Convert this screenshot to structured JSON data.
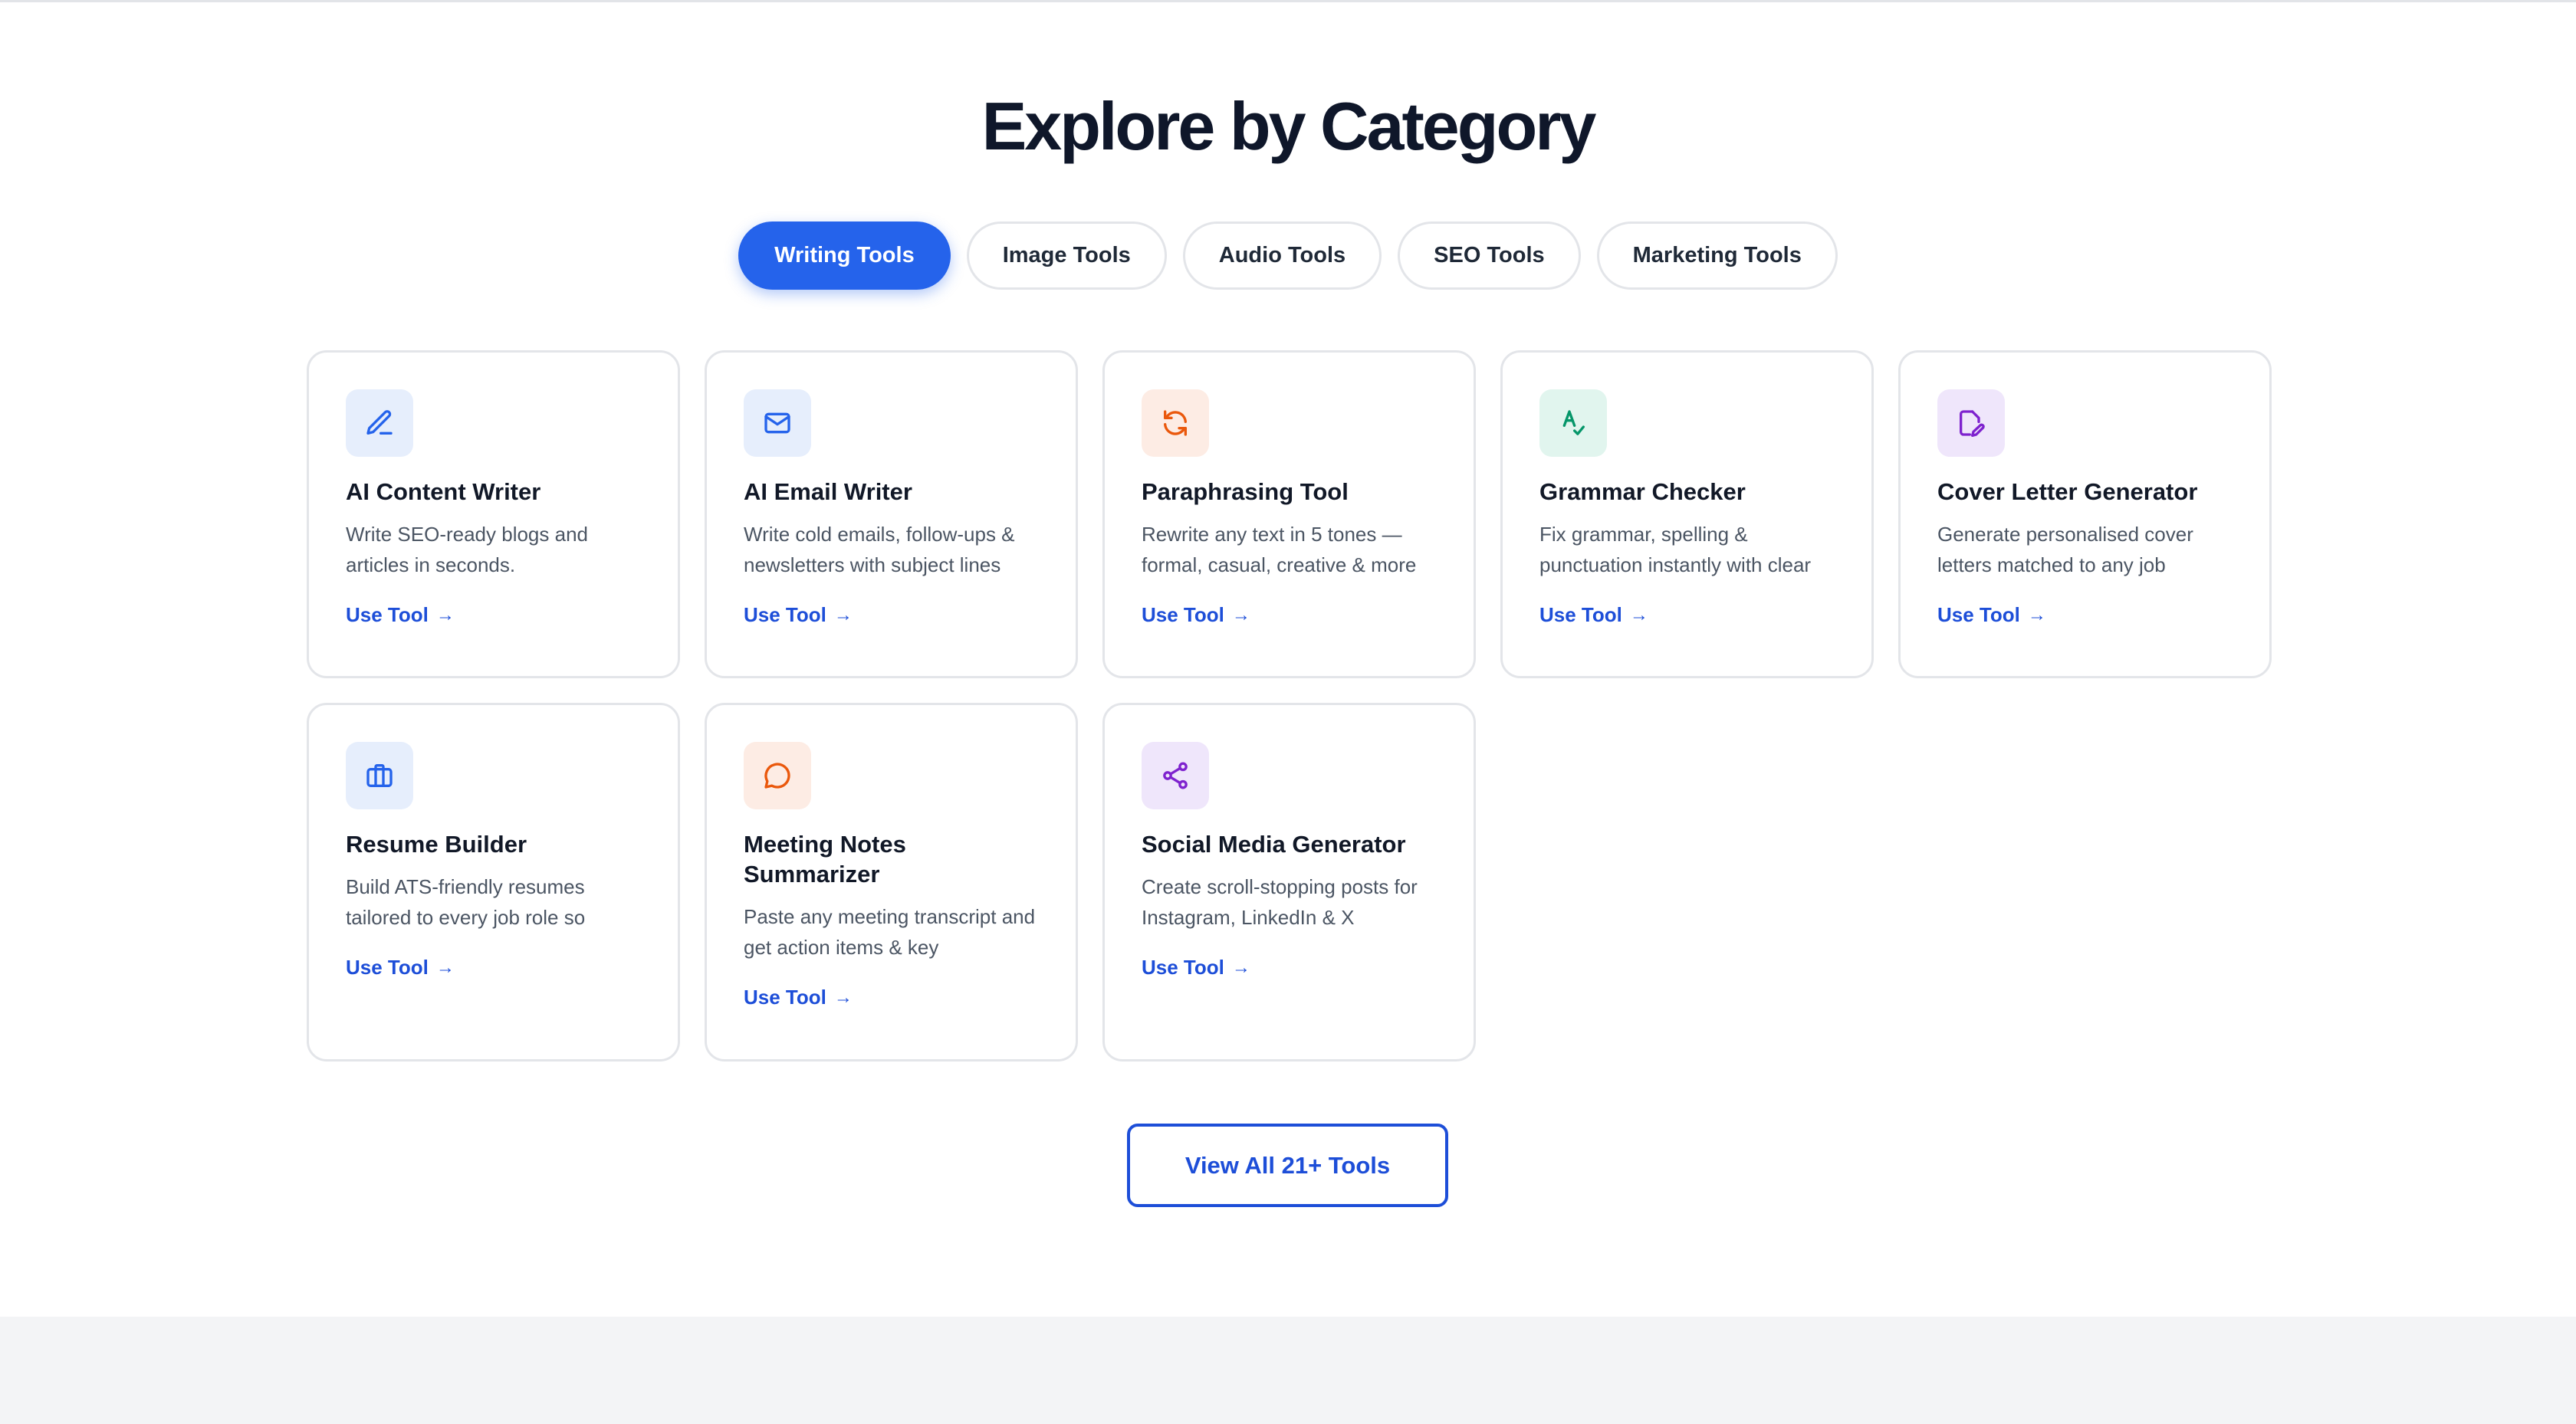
{
  "section": {
    "title": "Explore by Category"
  },
  "tabs": [
    {
      "label": "Writing Tools",
      "active": true
    },
    {
      "label": "Image Tools",
      "active": false
    },
    {
      "label": "Audio Tools",
      "active": false
    },
    {
      "label": "SEO Tools",
      "active": false
    },
    {
      "label": "Marketing Tools",
      "active": false
    }
  ],
  "cards": [
    {
      "title": "AI Content Writer",
      "desc": "Write SEO-ready blogs and articles in seconds.",
      "link": "Use Tool",
      "icon": "pencil-icon",
      "color": "#2563eb"
    },
    {
      "title": "AI Email Writer",
      "desc": "Write cold emails, follow-ups & newsletters with subject lines",
      "link": "Use Tool",
      "icon": "mail-icon",
      "color": "#2563eb"
    },
    {
      "title": "Paraphrasing Tool",
      "desc": "Rewrite any text in 5 tones — formal, casual, creative & more",
      "link": "Use Tool",
      "icon": "refresh-icon",
      "color": "#ea580c"
    },
    {
      "title": "Grammar Checker",
      "desc": "Fix grammar, spelling & punctuation instantly with clear",
      "link": "Use Tool",
      "icon": "spell-check-icon",
      "color": "#059669"
    },
    {
      "title": "Cover Letter Generator",
      "desc": "Generate personalised cover letters matched to any job",
      "link": "Use Tool",
      "icon": "file-edit-icon",
      "color": "#7e22ce"
    },
    {
      "title": "Resume Builder",
      "desc": "Build ATS-friendly resumes tailored to every job role so",
      "link": "Use Tool",
      "icon": "briefcase-icon",
      "color": "#2563eb"
    },
    {
      "title": "Meeting Notes Summarizer",
      "desc": "Paste any meeting transcript and get action items & key",
      "link": "Use Tool",
      "icon": "chat-bubble-icon",
      "color": "#ea580c"
    },
    {
      "title": "Social Media Generator",
      "desc": "Create scroll-stopping posts for Instagram, LinkedIn & X",
      "link": "Use Tool",
      "icon": "share-icon",
      "color": "#7e22ce"
    }
  ],
  "cta": {
    "label": "View All 21+ Tools"
  },
  "colors": {
    "accent": "#2563eb",
    "link": "#1d4ed8",
    "orange": "#ea580c",
    "green": "#059669",
    "purple": "#7e22ce"
  }
}
